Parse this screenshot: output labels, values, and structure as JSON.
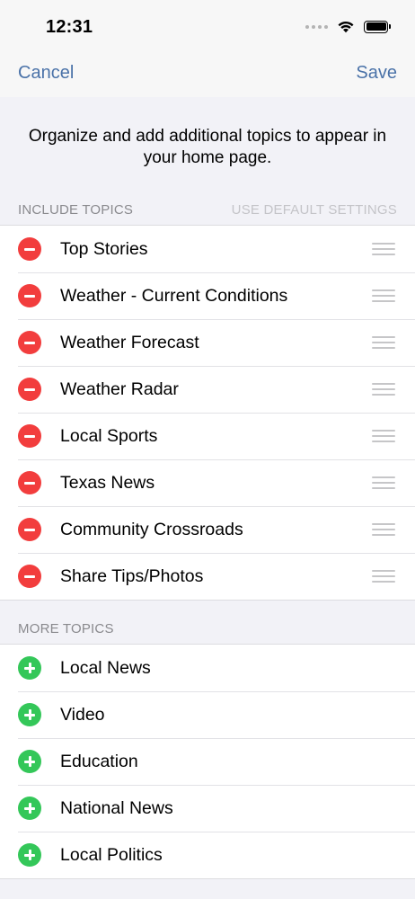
{
  "status": {
    "time": "12:31"
  },
  "nav": {
    "cancel": "Cancel",
    "save": "Save"
  },
  "intro": "Organize and add additional topics to appear in your home page.",
  "include": {
    "header": "INCLUDE TOPICS",
    "default_link": "USE DEFAULT SETTINGS",
    "items": [
      "Top Stories",
      "Weather - Current Conditions",
      "Weather Forecast",
      "Weather Radar",
      "Local Sports",
      "Texas News",
      "Community Crossroads",
      "Share Tips/Photos"
    ]
  },
  "more": {
    "header": "MORE TOPICS",
    "items": [
      "Local News",
      "Video",
      "Education",
      "National News",
      "Local Politics"
    ]
  },
  "colors": {
    "accent": "#4a72a8",
    "remove": "#f23d3d",
    "add": "#34c759"
  }
}
